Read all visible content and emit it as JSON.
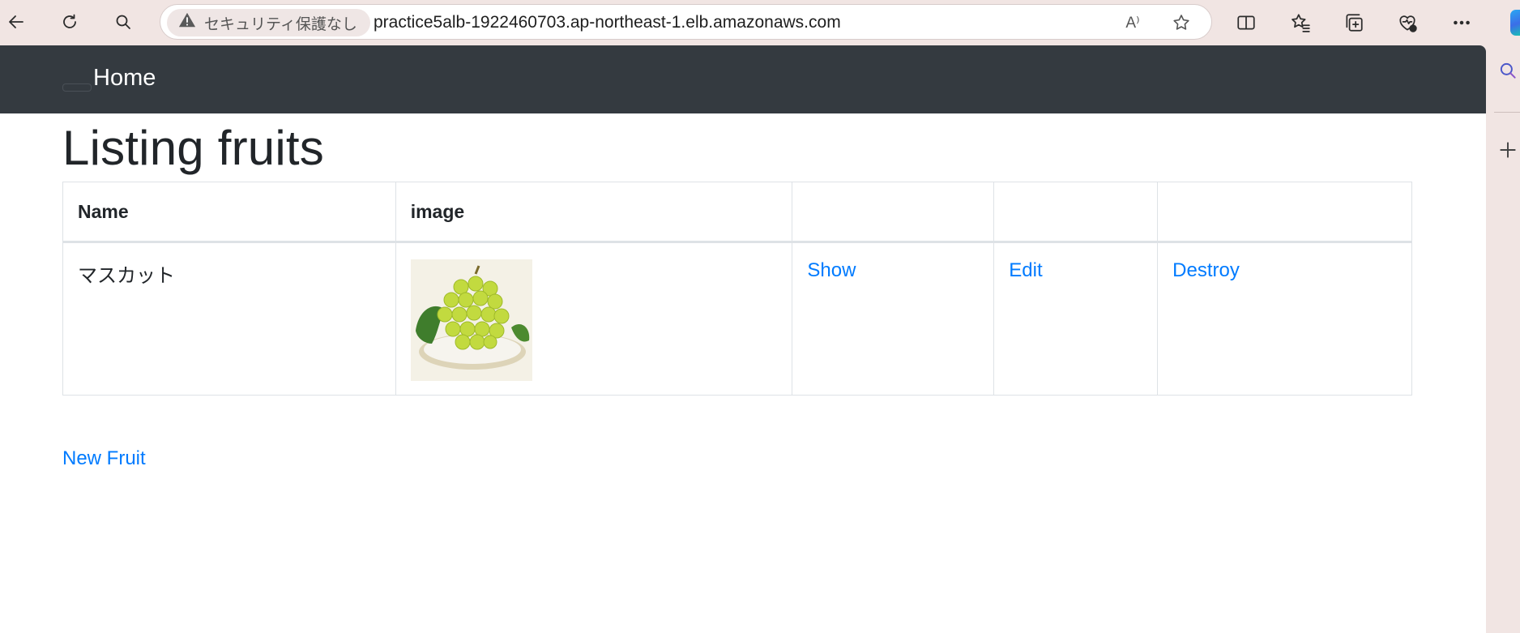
{
  "browser": {
    "security_label": "セキュリティ保護なし",
    "url": "practice5alb-1922460703.ap-northeast-1.elb.amazonaws.com",
    "read_aloud_icon_text": "A⁾",
    "icons": [
      "back-arrow-icon",
      "refresh-icon",
      "search-icon",
      "warning-icon",
      "read-aloud-icon",
      "favorite-star-icon",
      "split-screen-icon",
      "favorites-icon",
      "collections-icon",
      "browser-essentials-icon",
      "more-options-icon",
      "sidebar-search-icon",
      "sidebar-add-icon",
      "copilot-icon"
    ]
  },
  "navbar": {
    "brand": "Home",
    "background": "#343a40"
  },
  "page": {
    "title": "Listing fruits",
    "new_link": "New Fruit",
    "link_color": "#007bff"
  },
  "table": {
    "headers": [
      "Name",
      "image",
      "",
      "",
      ""
    ],
    "rows": [
      {
        "name": "マスカット",
        "image_icon": "muscat-grapes-image",
        "show": "Show",
        "edit": "Edit",
        "destroy": "Destroy"
      }
    ]
  }
}
